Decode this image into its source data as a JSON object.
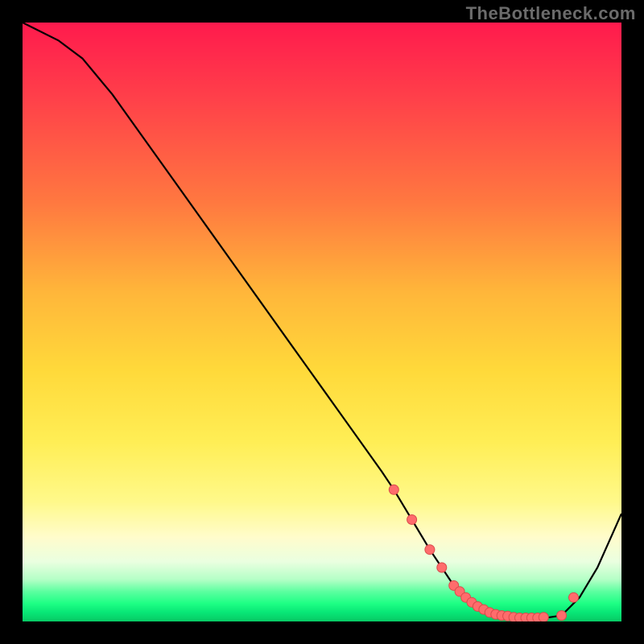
{
  "watermark": "TheBottleneck.com",
  "colors": {
    "background": "#000000",
    "watermark_text": "#6b6b6b",
    "curve_stroke": "#000000",
    "marker_fill": "#ff6c6c",
    "marker_stroke": "#d94b4b",
    "gradient_top": "#ff1a4d",
    "gradient_mid": "#ffd93a",
    "gradient_green": "#1eff84"
  },
  "chart_data": {
    "type": "line",
    "title": "",
    "xlabel": "",
    "ylabel": "",
    "xlim": [
      0,
      100
    ],
    "ylim": [
      0,
      100
    ],
    "grid": false,
    "legend": false,
    "x": [
      0,
      6,
      10,
      15,
      20,
      25,
      30,
      35,
      40,
      45,
      50,
      55,
      60,
      62,
      65,
      68,
      70,
      72,
      74,
      76,
      78,
      80,
      82,
      84,
      86,
      88,
      90,
      93,
      96,
      100
    ],
    "values": [
      100,
      97,
      94,
      88,
      81,
      74,
      67,
      60,
      53,
      46,
      39,
      32,
      25,
      22,
      17,
      12,
      9,
      6,
      4,
      2.5,
      1.5,
      1,
      0.7,
      0.6,
      0.6,
      0.7,
      1,
      4,
      9,
      18
    ],
    "markers": {
      "x": [
        62,
        65,
        68,
        70,
        72,
        73,
        74,
        75,
        76,
        77,
        78,
        79,
        80,
        81,
        82,
        83,
        84,
        85,
        86,
        87,
        90,
        92
      ],
      "y": [
        22,
        17,
        12,
        9,
        6,
        5,
        4,
        3.2,
        2.5,
        2,
        1.5,
        1.2,
        1,
        0.9,
        0.7,
        0.6,
        0.6,
        0.6,
        0.6,
        0.7,
        1,
        4
      ]
    },
    "annotations": []
  }
}
